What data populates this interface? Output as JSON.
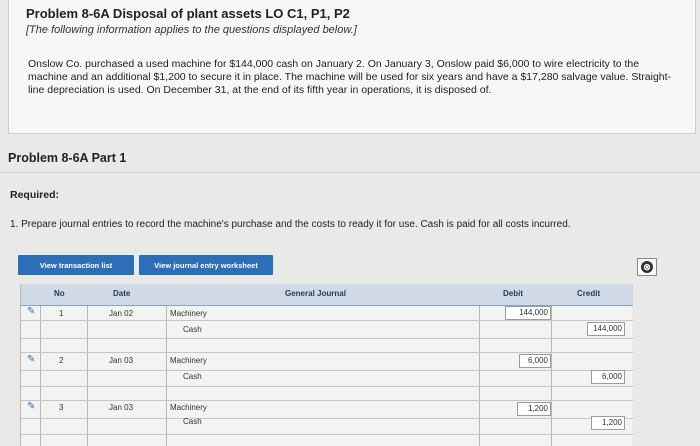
{
  "problem": {
    "title": "Problem 8-6A Disposal of plant assets LO C1, P1, P2",
    "note": "[The following information applies to the questions displayed below.]",
    "text": "Onslow Co. purchased a used machine for $144,000 cash on January 2. On January 3, Onslow paid $6,000 to wire electricity to the machine and an additional $1,200 to secure it in place. The machine will be used for six years and have a $17,280 salvage value. Straight-line depreciation is used. On December 31, at the end of its fifth year in operations, it is disposed of."
  },
  "part": {
    "heading": "Problem 8-6A Part 1",
    "required_label": "Required:",
    "instruction": "1. Prepare journal entries to record the machine's purchase and the costs to ready it for use. Cash is paid for all costs incurred."
  },
  "buttons": {
    "transaction_list": "View transaction list",
    "journal_worksheet": "View journal entry worksheet",
    "close_symbol": "⊗"
  },
  "journal": {
    "headers": {
      "no": "No",
      "date": "Date",
      "general_journal": "General Journal",
      "debit": "Debit",
      "credit": "Credit"
    },
    "entries": [
      {
        "no": "1",
        "date": "Jan 02",
        "debit_account": "Machinery",
        "credit_account": "Cash",
        "debit": "144,000",
        "credit": "144,000"
      },
      {
        "no": "2",
        "date": "Jan 03",
        "debit_account": "Machinery",
        "credit_account": "Cash",
        "debit": "6,000",
        "credit": "6,000"
      },
      {
        "no": "3",
        "date": "Jan 03",
        "debit_account": "Machinery",
        "credit_account": "Cash",
        "debit": "1,200",
        "credit": "1,200"
      }
    ]
  },
  "colors": {
    "button": "#2d6fb7",
    "header_bg": "#cfdae6",
    "page_bg": "#e9e9e7"
  },
  "icons": {
    "edit": "pencil-icon",
    "close": "close-circle-icon"
  }
}
